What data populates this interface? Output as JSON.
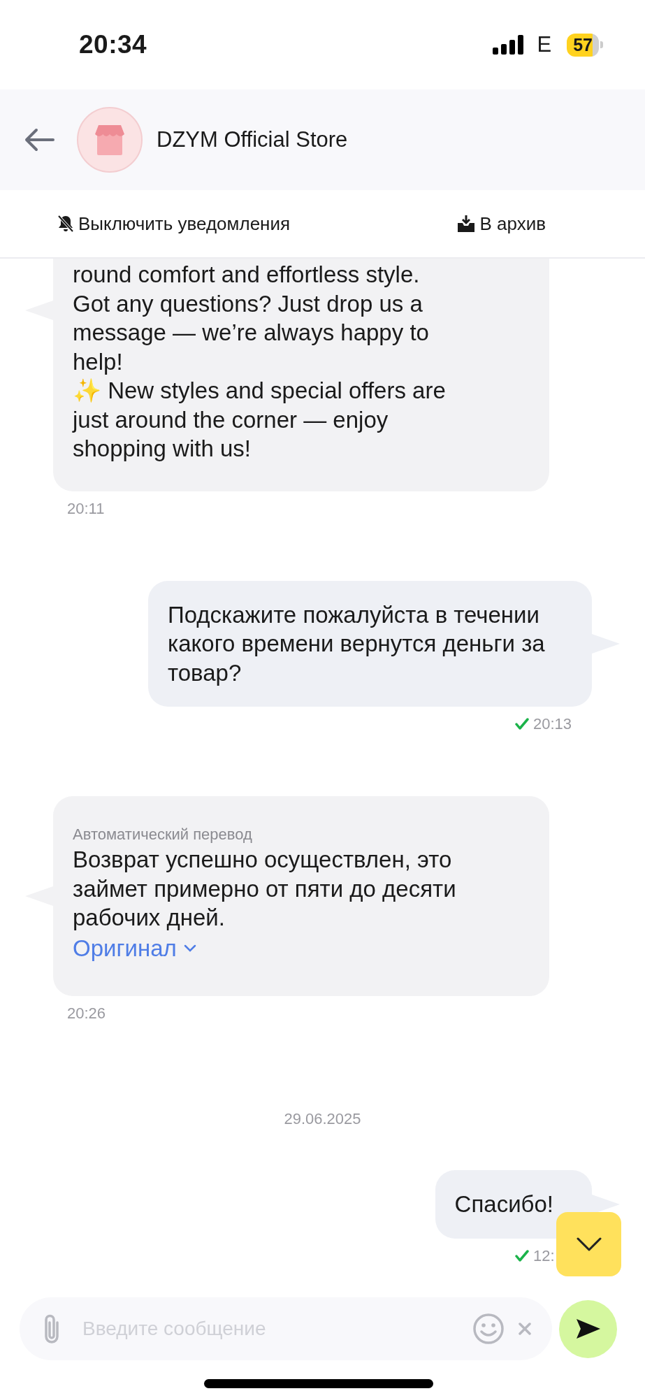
{
  "status_bar": {
    "time": "20:34",
    "network": "E",
    "battery": "57"
  },
  "header": {
    "title": "DZYM Official Store"
  },
  "actions": [
    {
      "kind": "mute",
      "label": "Выключить уведомления"
    },
    {
      "kind": "archive",
      "label": "В архив"
    }
  ],
  "messages": [
    {
      "kind": "incoming",
      "text": "round comfort and effortless style. Got any questions? Just drop us a message — we’re always happy to help!\n✨ New styles and special offers are just around the corner — enjoy shopping with us!",
      "time": "20:11"
    },
    {
      "kind": "outgoing",
      "text": "Подскажите пожалуйста в течении какого времени вернутся деньги за товар?",
      "time": "20:13",
      "read": true
    },
    {
      "kind": "incoming",
      "note": "Автоматический перевод",
      "text": "Возврат успешно осуществлен, это займет примерно от пяти до десяти рабочих дней.",
      "link": "Оригинал",
      "time": "20:26"
    },
    {
      "kind": "date",
      "text": "29.06.2025"
    },
    {
      "kind": "outgoing",
      "text": "Спасибо!",
      "time": "12:",
      "read": true
    }
  ],
  "composer": {
    "placeholder": "Введите сообщение"
  }
}
